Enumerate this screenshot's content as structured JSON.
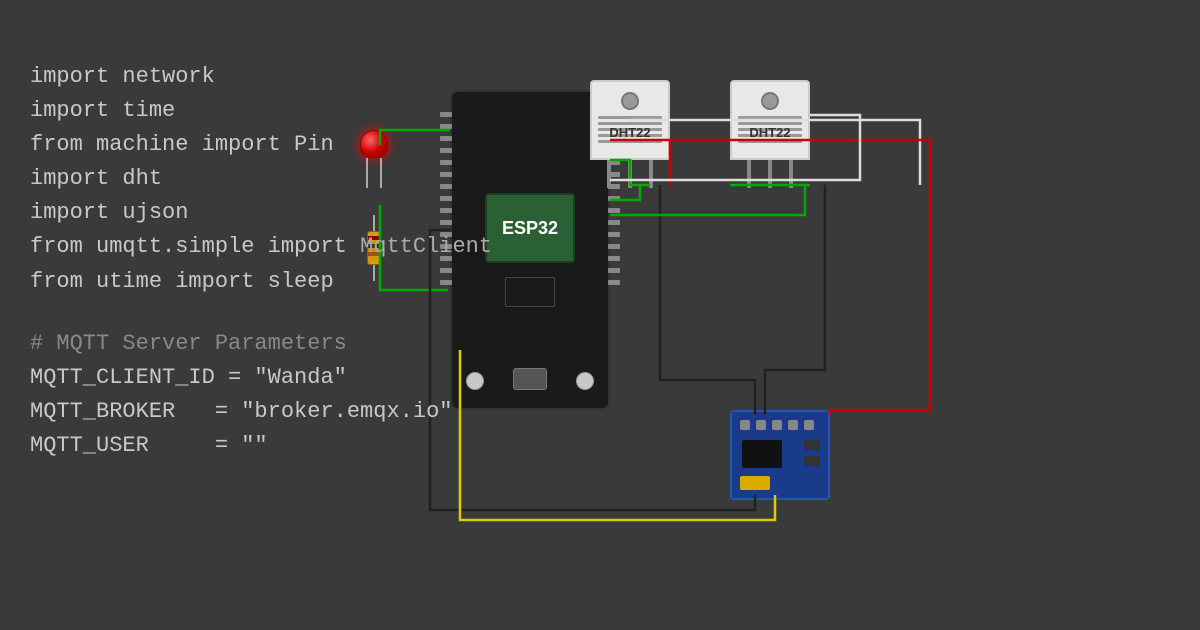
{
  "background_color": "#3a3a3a",
  "code_lines": [
    {
      "text": "import network",
      "type": "code"
    },
    {
      "text": "import time",
      "type": "code"
    },
    {
      "text": "from machine import Pin",
      "type": "code"
    },
    {
      "text": "import dht",
      "type": "code"
    },
    {
      "text": "import ujson",
      "type": "code"
    },
    {
      "text": "from umqtt.simple import MqttClient",
      "type": "code"
    },
    {
      "text": "from utime import sleep",
      "type": "code"
    },
    {
      "text": "",
      "type": "blank"
    },
    {
      "text": "# MQTT Server Parameters",
      "type": "comment"
    },
    {
      "text": "MQTT_CLIENT_ID = \"Wanda\"",
      "type": "code"
    },
    {
      "text": "MQTT_BROKER    = \"broker.emqx.io\"",
      "type": "code"
    },
    {
      "text": "MQTT_USER      = \"\"",
      "type": "code"
    }
  ],
  "esp32": {
    "label": "ESP32"
  },
  "sensors": [
    {
      "id": "dht22-1",
      "label": "DHT22"
    },
    {
      "id": "dht22-2",
      "label": "DHT22"
    }
  ],
  "colors": {
    "red_wire": "#cc0000",
    "green_wire": "#00aa00",
    "black_wire": "#111111",
    "yellow_wire": "#ddcc00",
    "white_wire": "#dddddd"
  }
}
